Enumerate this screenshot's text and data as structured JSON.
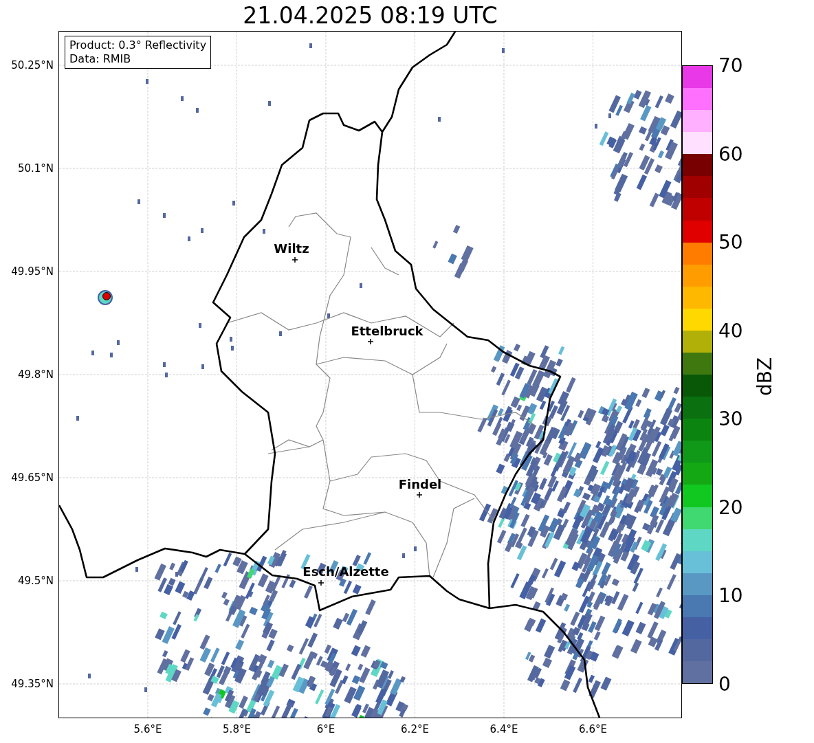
{
  "title": "21.04.2025 08:19 UTC",
  "map": {
    "info": [
      "Product: 0.3° Reflectivity",
      "Data: RMIB"
    ],
    "yticks": [
      "50.25°N",
      "50.1°N",
      "49.95°N",
      "49.8°N",
      "49.65°N",
      "49.5°N",
      "49.35°N"
    ],
    "xticks": [
      "5.6°E",
      "5.8°E",
      "6°E",
      "6.2°E",
      "6.4°E",
      "6.6°E"
    ],
    "cities": [
      "Wiltz",
      "Ettelbruck",
      "Findel",
      "Esch/Alzette"
    ]
  },
  "colorbar": {
    "label": "dBZ",
    "ticks": [
      "70",
      "60",
      "50",
      "40",
      "30",
      "20",
      "10",
      "0"
    ],
    "bins": [
      {
        "color": "#e838e8"
      },
      {
        "color": "#ff70ff"
      },
      {
        "color": "#ffb0ff"
      },
      {
        "color": "#ffe0ff"
      },
      {
        "color": "#780000"
      },
      {
        "color": "#a00000"
      },
      {
        "color": "#c00000"
      },
      {
        "color": "#e00000"
      },
      {
        "color": "#ff7c00"
      },
      {
        "color": "#ff9c00"
      },
      {
        "color": "#ffb800"
      },
      {
        "color": "#ffd800"
      },
      {
        "color": "#b0b008"
      },
      {
        "color": "#407810"
      },
      {
        "color": "#085808"
      },
      {
        "color": "#0a7010"
      },
      {
        "color": "#0c8410"
      },
      {
        "color": "#109818"
      },
      {
        "color": "#14a814"
      },
      {
        "color": "#10c820"
      },
      {
        "color": "#40d870"
      },
      {
        "color": "#5ed8c4"
      },
      {
        "color": "#68c0d8"
      },
      {
        "color": "#5a98c4"
      },
      {
        "color": "#4a78b0"
      },
      {
        "color": "#4660a4"
      },
      {
        "color": "#5468a0"
      },
      {
        "color": "#6070a0"
      }
    ]
  }
}
